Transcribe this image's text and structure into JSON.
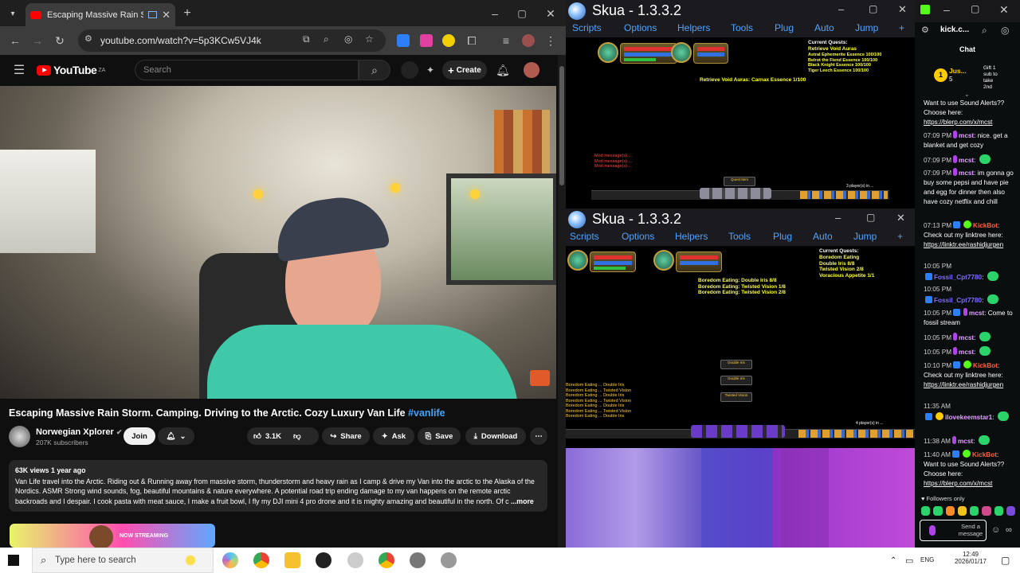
{
  "browser": {
    "tab_title": "Escaping Massive Rain Storm. Camping. Driving to the Arctic. Cozy Luxury Van Life",
    "url": "youtube.com/watch?v=5p3KCw5VJ4k"
  },
  "youtube": {
    "logo_text": "YouTube",
    "logo_region": "ZA",
    "search_placeholder": "Search",
    "create_label": "Create",
    "video_title": "Escaping Massive Rain Storm. Camping. Driving to the Arctic. Cozy Luxury Van Life",
    "video_hashtag": "#vanlife",
    "channel_name": "Norwegian Xplorer",
    "channel_subs": "207K subscribers",
    "join_label": "Join",
    "like_count": "3.1K",
    "share_label": "Share",
    "ask_label": "Ask",
    "save_label": "Save",
    "download_label": "Download",
    "views_line": "63K views  1 year ago",
    "description": "Van Life travel into the Arctic. Riding out & Running away from massive storm, thunderstorm and heavy rain as I camp & drive my Van into the arctic to the Alaska of the Nordics. ASMR Strong wind sounds, fog, beautiful mountains & nature everywhere. A potential road trip ending damage to my van happens on the remote arctic backroads and I despair. I cook pasta with meat sauce, I make a fruit bowl, I fly my DJI mini 4 pro drone and it is mighty amazing and beautiful in the north. Of c",
    "more_label": "...more",
    "streaming_banner": "NOW STREAMING"
  },
  "skua1": {
    "title": "Skua - 1.3.3.2",
    "menu": [
      "Scripts",
      "Options",
      "Helpers",
      "Tools",
      "Plug",
      "Auto",
      "Jump",
      "+"
    ],
    "quest_header": "Current Quests:",
    "quest_name": "Retrieve Void Auras",
    "quest_lines": "Astral Ephemerite Essence 100/100\nBelrot the Fiend Essence 100/100\nBlack Knight Essence 100/100\nTiger Leech Essence 100/100",
    "center_text": "Retrieve Void Auras: Carnax Essence 1/100",
    "player_count": "3 player(s) in ..."
  },
  "skua2": {
    "title": "Skua - 1.3.3.2",
    "menu": [
      "Scripts",
      "Options",
      "Helpers",
      "Tools",
      "Plug",
      "Auto",
      "Jump",
      "+"
    ],
    "quest_header": "Current Quests:",
    "quest_lines": "Boredom Eating\nDouble Iris 8/8\nTwisted Vision 2/8\nVoracious Appetite 1/1",
    "center_text": "Boredom Eating: Double Iris 8/8\nBoredom Eating: Twisted Vision 1/8\nBoredom Eating: Twisted Vision 2/8",
    "quest_boxes": [
      "Double Iris",
      "Double Iris",
      "Twisted Vision"
    ],
    "player_count": "4 player(s) in ..."
  },
  "kick": {
    "url": "kick.c...",
    "chat_title": "Chat",
    "gift_user": "Jus...",
    "gift_count": "5",
    "gift_info": "Gift 1\nsub to\ntake\n2nd",
    "messages": [
      {
        "time": "",
        "user": "",
        "text": "Want to use Sound Alerts?? Choose here:",
        "link": "https://blerp.com/x/mcst"
      },
      {
        "time": "07:09 PM",
        "user": "mcst",
        "text": "nice. get a blanket and get cozy",
        "link": ""
      },
      {
        "time": "07:09 PM",
        "user": "mcst",
        "text": "",
        "link": ""
      },
      {
        "time": "07:09 PM",
        "user": "mcst",
        "text": "im gonna go buy some pepsi and have pie and egg for dinner then also have cozy netflix and chill",
        "link": ""
      },
      {
        "time": "07:13 PM",
        "user": "KickBot",
        "text": "Check out my linktree here:",
        "link": "https://linktr.ee/rashidjurgen"
      },
      {
        "time": "10:05 PM",
        "user": "Fossil_Cpt7780",
        "text": "",
        "link": ""
      },
      {
        "time": "10:05 PM",
        "user": "Fossil_Cpt7780",
        "text": "",
        "link": ""
      },
      {
        "time": "10:05 PM",
        "user": "mcst",
        "text": "Come to fossil stream",
        "link": ""
      },
      {
        "time": "10:05 PM",
        "user": "mcst",
        "text": "",
        "link": ""
      },
      {
        "time": "10:05 PM",
        "user": "mcst",
        "text": "",
        "link": ""
      },
      {
        "time": "10:10 PM",
        "user": "KickBot",
        "text": "Check out my linktree here:",
        "link": "https://linktr.ee/rashidjurgen"
      },
      {
        "time": "11:35 AM",
        "user": "ilovekeemstar1",
        "text": "",
        "link": ""
      },
      {
        "time": "11:38 AM",
        "user": "mcst",
        "text": "",
        "link": ""
      },
      {
        "time": "11:40 AM",
        "user": "KickBot",
        "text": "Want to use Sound Alerts?? Choose here:",
        "link": "https://blerp.com/x/mcst"
      }
    ],
    "followers_only": "Followers only",
    "send_placeholder": "Send a message"
  },
  "taskbar": {
    "search_placeholder": "Type here to search",
    "lang": "ENG",
    "time": "12:49",
    "date": "2026/01/17"
  },
  "colors": {
    "youtube_red": "#ff0000",
    "link_blue": "#3ea6ff",
    "kick_green": "#53fc18",
    "skua_menu": "#4fa3ff"
  }
}
